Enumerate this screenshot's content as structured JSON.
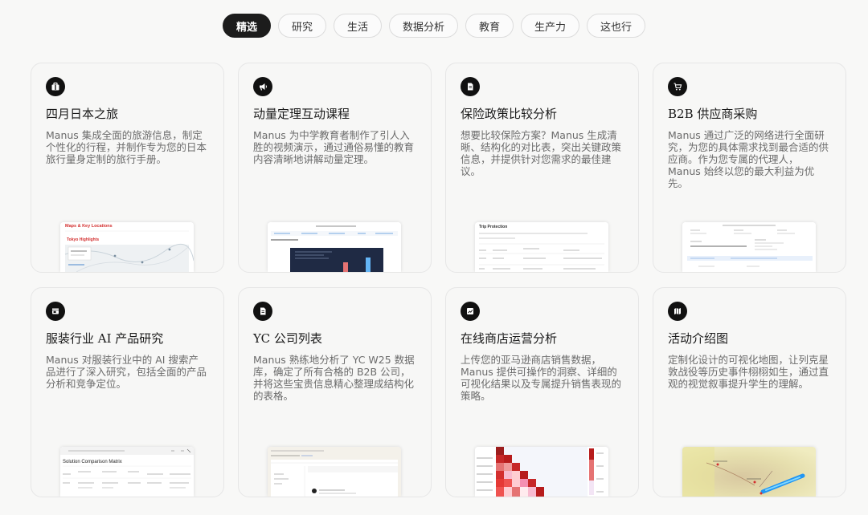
{
  "tabs": [
    {
      "label": "精选",
      "active": true
    },
    {
      "label": "研究",
      "active": false
    },
    {
      "label": "生活",
      "active": false
    },
    {
      "label": "数据分析",
      "active": false
    },
    {
      "label": "教育",
      "active": false
    },
    {
      "label": "生产力",
      "active": false
    },
    {
      "label": "这也行",
      "active": false
    }
  ],
  "cards": [
    {
      "icon": "suitcase-icon",
      "title": "四月日本之旅",
      "desc": "Manus 集成全面的旅游信息，制定个性化的行程，并制作专为您的日本旅行量身定制的旅行手册。"
    },
    {
      "icon": "megaphone-icon",
      "title": "动量定理互动课程",
      "desc": "Manus 为中学教育者制作了引人入胜的视频演示，通过通俗易懂的教育内容清晰地讲解动量定理。"
    },
    {
      "icon": "document-icon",
      "title": "保险政策比较分析",
      "desc": "想要比较保险方案？Manus 生成清晰、结构化的对比表，突出关键政策信息，并提供针对您需求的最佳建议。"
    },
    {
      "icon": "cart-icon",
      "title": "B2B 供应商采购",
      "desc": "Manus 通过广泛的网络进行全面研究，为您的具体需求找到最合适的供应商。作为您专属的代理人，Manus 始终以您的最大利益为优先。"
    },
    {
      "icon": "browser-icon",
      "title": "服装行业 AI 产品研究",
      "desc": "Manus 对服装行业中的 AI 搜索产品进行了深入研究，包括全面的产品分析和竞争定位。"
    },
    {
      "icon": "document-icon",
      "title": "YC 公司列表",
      "desc": "Manus 熟练地分析了 YC W25 数据库，确定了所有合格的 B2B 公司，并将这些宝贵信息精心整理成结构化的表格。"
    },
    {
      "icon": "chart-icon",
      "title": "在线商店运营分析",
      "desc": "上传您的亚马逊商店销售数据，Manus 提供可操作的洞察、详细的可视化结果以及专属提升销售表现的策略。"
    },
    {
      "icon": "map-icon",
      "title": "活动介绍图",
      "desc": "定制化设计的可视化地图，让列克星敦战役等历史事件栩栩如生，通过直观的视觉叙事提升学生的理解。"
    }
  ],
  "previews": {
    "travel": {
      "heading": "Maps & Key Locations",
      "subheading": "Tokyo Highlights"
    },
    "insurance": {
      "heading": "Trip Protection"
    },
    "apparel": {
      "heading": "Solution Comparison Matrix"
    }
  }
}
